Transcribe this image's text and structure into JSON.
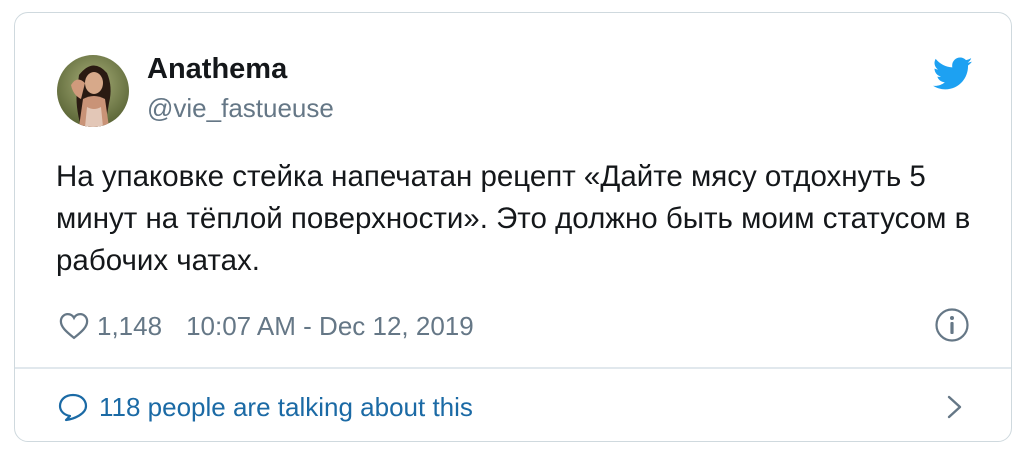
{
  "tweet": {
    "author": {
      "name": "Anathema",
      "handle": "@vie_fastueuse",
      "avatar_icon": "user-avatar-photo"
    },
    "text": "На упаковке стейка напечатан рецепт «Дайте мясу отдохнуть 5 минут на тёплой поверхности». Это должно быть моим статусом в рабочих чатах.",
    "likes": "1,148",
    "timestamp": "10:07 AM - Dec 12, 2019",
    "conversation_label": "118 people are talking about this"
  },
  "icons": {
    "brand": "twitter-bird-icon",
    "like": "heart-icon",
    "info": "info-icon",
    "conversation": "speech-bubble-icon",
    "more": "chevron-right-icon"
  },
  "colors": {
    "brand": "#1da1f2",
    "text_primary": "#14171a",
    "text_secondary": "#657786",
    "link": "#1b6aa5",
    "border": "#cfd9de"
  }
}
